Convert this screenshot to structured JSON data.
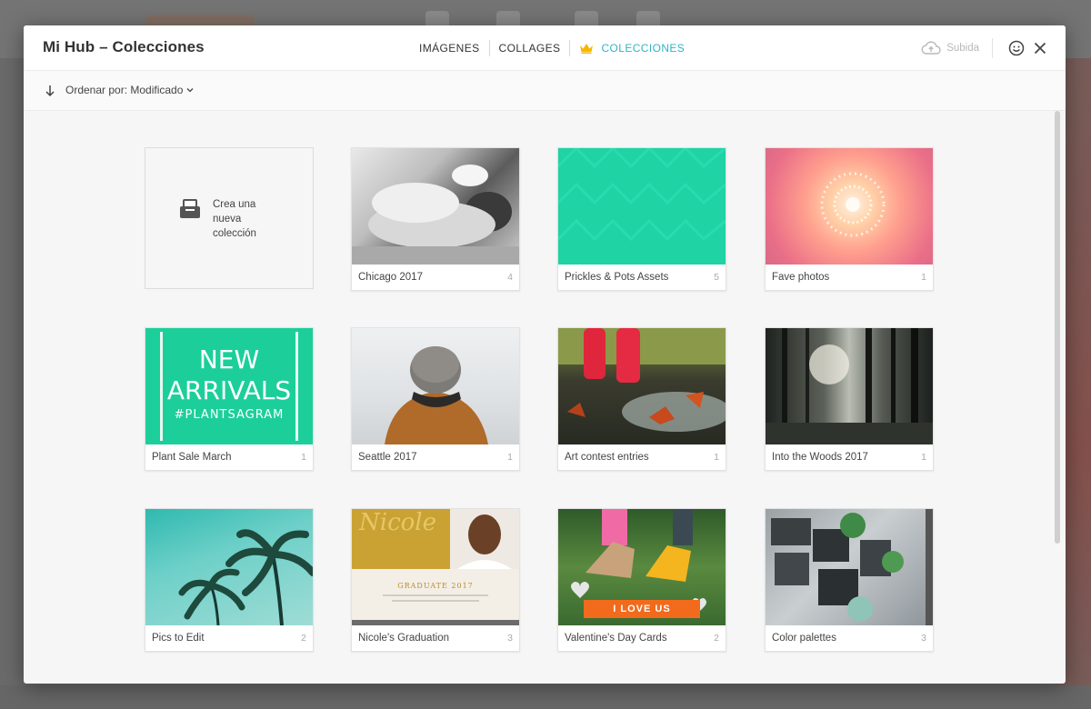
{
  "modal": {
    "title": "Mi Hub – Colecciones",
    "tabs": [
      {
        "label": "IMÁGENES"
      },
      {
        "label": "COLLAGES"
      },
      {
        "label": "COLECCIONES",
        "active": true
      }
    ],
    "upload_label": "Subida"
  },
  "toolbar": {
    "sort_label": "Ordenar por: Modificado"
  },
  "new_collection": {
    "line1": "Crea una",
    "line2": "nueva",
    "line3": "colección"
  },
  "collections": [
    {
      "name": "Chicago 2017",
      "count": "4",
      "thumb": "chicago"
    },
    {
      "name": "Prickles & Pots Assets",
      "count": "5",
      "thumb": "prickles"
    },
    {
      "name": "Fave photos",
      "count": "1",
      "thumb": "fave"
    },
    {
      "name": "Plant Sale March",
      "count": "1",
      "thumb": "plant"
    },
    {
      "name": "Seattle 2017",
      "count": "1",
      "thumb": "seattle"
    },
    {
      "name": "Art contest entries",
      "count": "1",
      "thumb": "art"
    },
    {
      "name": "Into the Woods 2017",
      "count": "1",
      "thumb": "woods"
    },
    {
      "name": "Pics to Edit",
      "count": "2",
      "thumb": "pics"
    },
    {
      "name": "Nicole's Graduation",
      "count": "3",
      "thumb": "nicole"
    },
    {
      "name": "Valentine's Day Cards",
      "count": "2",
      "thumb": "valentine"
    },
    {
      "name": "Color palettes",
      "count": "3",
      "thumb": "palette"
    }
  ],
  "thumb_text": {
    "plant_line1": "NEW",
    "plant_line2": "ARRIVALS",
    "plant_line3": "#PLANTSAGRAM",
    "nicole_script": "Nicole",
    "nicole_grad": "GRADUATE 2017",
    "valentine_banner": "I LOVE US"
  },
  "colors": {
    "accent": "#30b4c4",
    "crown": "#f5b800"
  }
}
